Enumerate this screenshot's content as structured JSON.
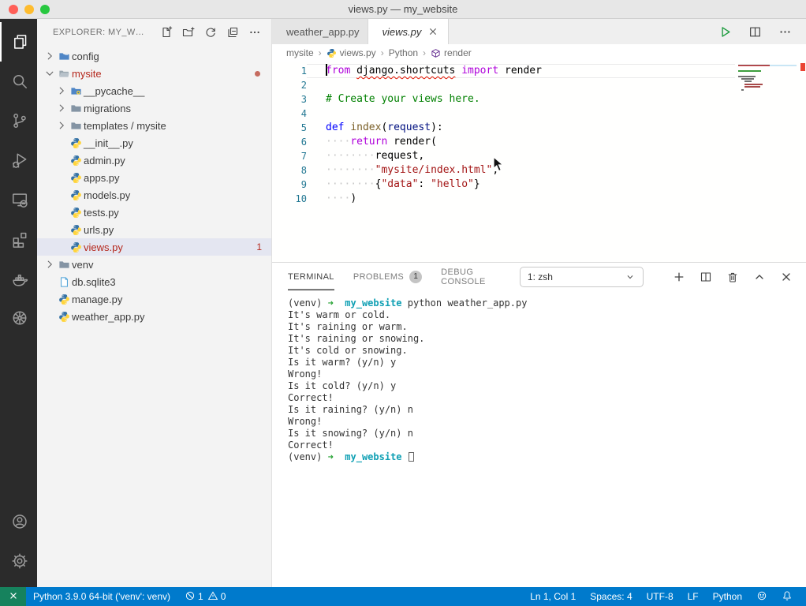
{
  "window": {
    "title": "views.py — my_website"
  },
  "colors": {
    "accent_blue": "#007acc",
    "remote_green": "#16825d",
    "error_red": "#b5281d",
    "squiggle_red": "#e51400",
    "keyword_purple": "#af00db",
    "string_red": "#a31515",
    "comment_green": "#008000"
  },
  "activity_bar": {
    "top": [
      {
        "name": "explorer",
        "active": true
      },
      {
        "name": "search"
      },
      {
        "name": "source-control"
      },
      {
        "name": "run-and-debug"
      },
      {
        "name": "remote-explorer"
      },
      {
        "name": "extensions"
      },
      {
        "name": "docker"
      },
      {
        "name": "kubernetes"
      }
    ],
    "bottom": [
      {
        "name": "accounts"
      },
      {
        "name": "settings"
      }
    ]
  },
  "explorer": {
    "header": "EXPLORER: MY_W…",
    "actions": [
      "new-file",
      "new-folder",
      "refresh-explorer",
      "collapse-folders",
      "more-actions"
    ],
    "tree": [
      {
        "label": "config",
        "icon": "folder-blue",
        "chevron": "right",
        "indent": 0
      },
      {
        "label": "mysite",
        "icon": "folder-open",
        "chevron": "down",
        "indent": 0,
        "error": true,
        "dot": true
      },
      {
        "label": "__pycache__",
        "icon": "folder-python",
        "chevron": "right",
        "indent": 1
      },
      {
        "label": "migrations",
        "icon": "folder-gray",
        "chevron": "right",
        "indent": 1
      },
      {
        "label": "templates / mysite",
        "icon": "folder-gray",
        "chevron": "right",
        "indent": 1
      },
      {
        "label": "__init__.py",
        "icon": "python",
        "indent": 1
      },
      {
        "label": "admin.py",
        "icon": "python",
        "indent": 1
      },
      {
        "label": "apps.py",
        "icon": "python",
        "indent": 1
      },
      {
        "label": "models.py",
        "icon": "python",
        "indent": 1
      },
      {
        "label": "tests.py",
        "icon": "python",
        "indent": 1
      },
      {
        "label": "urls.py",
        "icon": "python",
        "indent": 1
      },
      {
        "label": "views.py",
        "icon": "python",
        "indent": 1,
        "error": true,
        "badge": "1",
        "selected": true
      },
      {
        "label": "venv",
        "icon": "folder-gray",
        "chevron": "right",
        "indent": 0
      },
      {
        "label": "db.sqlite3",
        "icon": "db-file",
        "indent": 0
      },
      {
        "label": "manage.py",
        "icon": "python",
        "indent": 0
      },
      {
        "label": "weather_app.py",
        "icon": "python",
        "indent": 0
      }
    ]
  },
  "editor": {
    "tabs": [
      {
        "label": "weather_app.py",
        "active": false
      },
      {
        "label": "views.py",
        "active": true,
        "preview": true
      }
    ],
    "actions": [
      "run",
      "split-editor",
      "more-actions"
    ],
    "breadcrumb": [
      {
        "label": "mysite"
      },
      {
        "label": "views.py",
        "icon": "python"
      },
      {
        "label": "Python"
      },
      {
        "label": "render",
        "icon": "symbol-cube"
      }
    ],
    "lines": [
      {
        "n": "1",
        "current": true,
        "tokens": [
          {
            "t": "from",
            "c": "kw",
            "cursor": true
          },
          {
            "t": " "
          },
          {
            "t": "django.shortcuts",
            "squiggle": true
          },
          {
            "t": " "
          },
          {
            "t": "import",
            "c": "kw"
          },
          {
            "t": " render"
          }
        ]
      },
      {
        "n": "2",
        "tokens": []
      },
      {
        "n": "3",
        "tokens": [
          {
            "t": "# Create your views here.",
            "c": "com"
          }
        ]
      },
      {
        "n": "4",
        "tokens": []
      },
      {
        "n": "5",
        "tokens": [
          {
            "t": "def",
            "c": "def"
          },
          {
            "t": " "
          },
          {
            "t": "index",
            "c": "fn"
          },
          {
            "t": "("
          },
          {
            "t": "request",
            "c": "param"
          },
          {
            "t": "):"
          }
        ]
      },
      {
        "n": "6",
        "tokens": [
          {
            "t": "····",
            "c": "ws"
          },
          {
            "t": "return",
            "c": "kw"
          },
          {
            "t": " render("
          }
        ]
      },
      {
        "n": "7",
        "tokens": [
          {
            "t": "········",
            "c": "ws"
          },
          {
            "t": "request,"
          }
        ]
      },
      {
        "n": "8",
        "tokens": [
          {
            "t": "········",
            "c": "ws"
          },
          {
            "t": "\"mysite/index.html\"",
            "c": "str"
          },
          {
            "t": ","
          }
        ]
      },
      {
        "n": "9",
        "tokens": [
          {
            "t": "········",
            "c": "ws"
          },
          {
            "t": "{"
          },
          {
            "t": "\"data\"",
            "c": "str"
          },
          {
            "t": ": "
          },
          {
            "t": "\"hello\"",
            "c": "str"
          },
          {
            "t": "}"
          }
        ]
      },
      {
        "n": "10",
        "tokens": [
          {
            "t": "····",
            "c": "ws"
          },
          {
            "t": ")"
          }
        ]
      }
    ]
  },
  "panel": {
    "tabs": [
      {
        "label": "TERMINAL",
        "active": true
      },
      {
        "label": "PROBLEMS",
        "badge": "1"
      },
      {
        "label": "DEBUG CONSOLE"
      }
    ],
    "shell_select": "1: zsh",
    "actions": [
      "new-terminal",
      "split-terminal",
      "kill-terminal",
      "maximize-panel",
      "close-panel"
    ],
    "terminal": [
      [
        {
          "t": "(venv) "
        },
        {
          "t": "➜",
          "c": "green"
        },
        {
          "t": "  "
        },
        {
          "t": "my_website",
          "c": "cyan"
        },
        {
          "t": " python weather_app.py"
        }
      ],
      [
        {
          "t": "It's warm or cold."
        }
      ],
      [
        {
          "t": "It's raining or warm."
        }
      ],
      [
        {
          "t": "It's raining or snowing."
        }
      ],
      [
        {
          "t": "It's cold or snowing."
        }
      ],
      [
        {
          "t": "Is it warm? (y/n) y"
        }
      ],
      [
        {
          "t": "Wrong!"
        }
      ],
      [
        {
          "t": "Is it cold? (y/n) y"
        }
      ],
      [
        {
          "t": "Correct!"
        }
      ],
      [
        {
          "t": "Is it raining? (y/n) n"
        }
      ],
      [
        {
          "t": "Wrong!"
        }
      ],
      [
        {
          "t": "Is it snowing? (y/n) n"
        }
      ],
      [
        {
          "t": "Correct!"
        }
      ],
      [
        {
          "t": "(venv) "
        },
        {
          "t": "➜",
          "c": "green"
        },
        {
          "t": "  "
        },
        {
          "t": "my_website",
          "c": "cyan"
        },
        {
          "t": " "
        },
        {
          "cursor": true
        }
      ]
    ]
  },
  "status_bar": {
    "python_version": "Python 3.9.0 64-bit ('venv': venv)",
    "errors": "1",
    "warnings": "0",
    "right": [
      {
        "label": "Ln 1, Col 1",
        "name": "cursor-position"
      },
      {
        "label": "Spaces: 4",
        "name": "indentation"
      },
      {
        "label": "UTF-8",
        "name": "encoding"
      },
      {
        "label": "LF",
        "name": "end-of-line"
      },
      {
        "label": "Python",
        "name": "language-mode"
      }
    ]
  }
}
